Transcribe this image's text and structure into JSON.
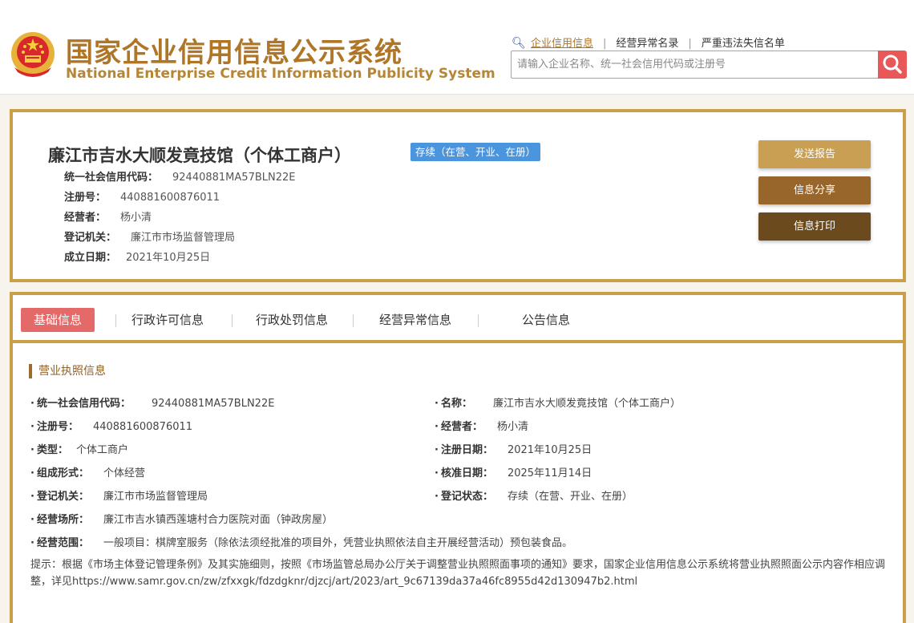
{
  "header": {
    "title_cn": "国家企业信用信息公示系统",
    "title_en": "National Enterprise Credit Information Publicity System",
    "links": [
      "企业信用信息",
      "经营异常名录",
      "严重违法失信名单"
    ],
    "search_placeholder": "请输入企业名称、统一社会信用代码或注册号"
  },
  "summary": {
    "name": "廉江市吉水大顺发竟技馆（个体工商户）",
    "status": "存续（在营、开业、在册）",
    "fields": [
      {
        "label": "统一社会信用代码：",
        "value": "92440881MA57BLN22E"
      },
      {
        "label": "注册号：",
        "value": "440881600876011"
      },
      {
        "label": "经营者：",
        "value": "杨小清"
      },
      {
        "label": "登记机关：",
        "value": "廉江市市场监督管理局"
      },
      {
        "label": "成立日期：",
        "value": "2021年10月25日"
      }
    ],
    "buttons": {
      "send": "发送报告",
      "share": "信息分享",
      "print": "信息打印"
    }
  },
  "tabs": [
    "基础信息",
    "行政许可信息",
    "行政处罚信息",
    "经营异常信息",
    "公告信息"
  ],
  "license": {
    "section_title": "营业执照信息",
    "left": [
      {
        "label": "统一社会信用代码：",
        "value": "92440881MA57BLN22E"
      },
      {
        "label": "注册号：",
        "value": "440881600876011"
      },
      {
        "label": "类型：",
        "value": "个体工商户"
      },
      {
        "label": "组成形式：",
        "value": "个体经营"
      },
      {
        "label": "登记机关：",
        "value": "廉江市市场监督管理局"
      },
      {
        "label": "经营场所：",
        "value": "廉江市吉水镇西莲塘村合力医院对面（钟政房屋）"
      },
      {
        "label": "经营范围：",
        "value": "一般项目：棋牌室服务（除依法须经批准的项目外，凭营业执照依法自主开展经营活动）预包装食品。"
      }
    ],
    "right": [
      {
        "label": "名称：",
        "value": "廉江市吉水大顺发竟技馆（个体工商户）"
      },
      {
        "label": "经营者：",
        "value": "杨小清"
      },
      {
        "label": "注册日期：",
        "value": "2021年10月25日"
      },
      {
        "label": "核准日期：",
        "value": "2025年11月14日"
      },
      {
        "label": "登记状态：",
        "value": "存续（在营、开业、在册）"
      }
    ],
    "notice": "提示：根据《市场主体登记管理条例》及其实施细则，按照《市场监管总局办公厅关于调整营业执照照面事项的通知》要求，国家企业信用信息公示系统将营业执照照面公示内容作相应调整，详见https://www.samr.gov.cn/zw/zfxxgk/fdzdgknr/djzcj/art/2023/art_9c67139da37a46fc8955d42d130947b2.html"
  },
  "colors": {
    "gold": "#c99f4a",
    "badge_blue": "#4a95de",
    "tab_active": "#e46a6a",
    "search_red": "#e95858"
  }
}
